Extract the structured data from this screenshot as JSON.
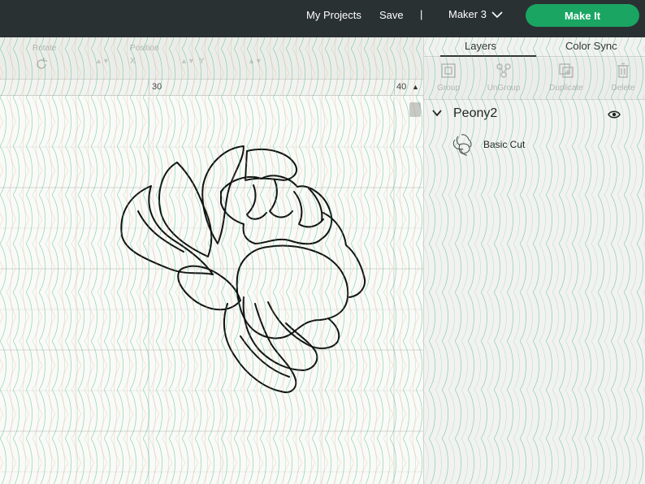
{
  "header": {
    "my_projects": "My Projects",
    "save": "Save",
    "separator": "|",
    "machine": "Maker 3",
    "make_it": "Make It"
  },
  "edit_toolbar": {
    "rotate_label": "Rotate",
    "position_label": "Position",
    "x_label": "X",
    "y_label": "Y"
  },
  "ruler": {
    "marks": [
      "30",
      "40"
    ]
  },
  "panel": {
    "tabs": [
      "Layers",
      "Color Sync"
    ],
    "actions": [
      {
        "label": "Group",
        "icon": "group-icon"
      },
      {
        "label": "UnGroup",
        "icon": "ungroup-icon"
      },
      {
        "label": "Duplicate",
        "icon": "duplicate-icon"
      },
      {
        "label": "Delete",
        "icon": "delete-icon"
      }
    ],
    "group_name": "Peony2",
    "layer_name": "Basic Cut"
  },
  "colors": {
    "header_bg": "#2a3133",
    "accent": "#1aa563",
    "pattern_green": "#2bb673",
    "pattern_orange": "#e8a060"
  }
}
